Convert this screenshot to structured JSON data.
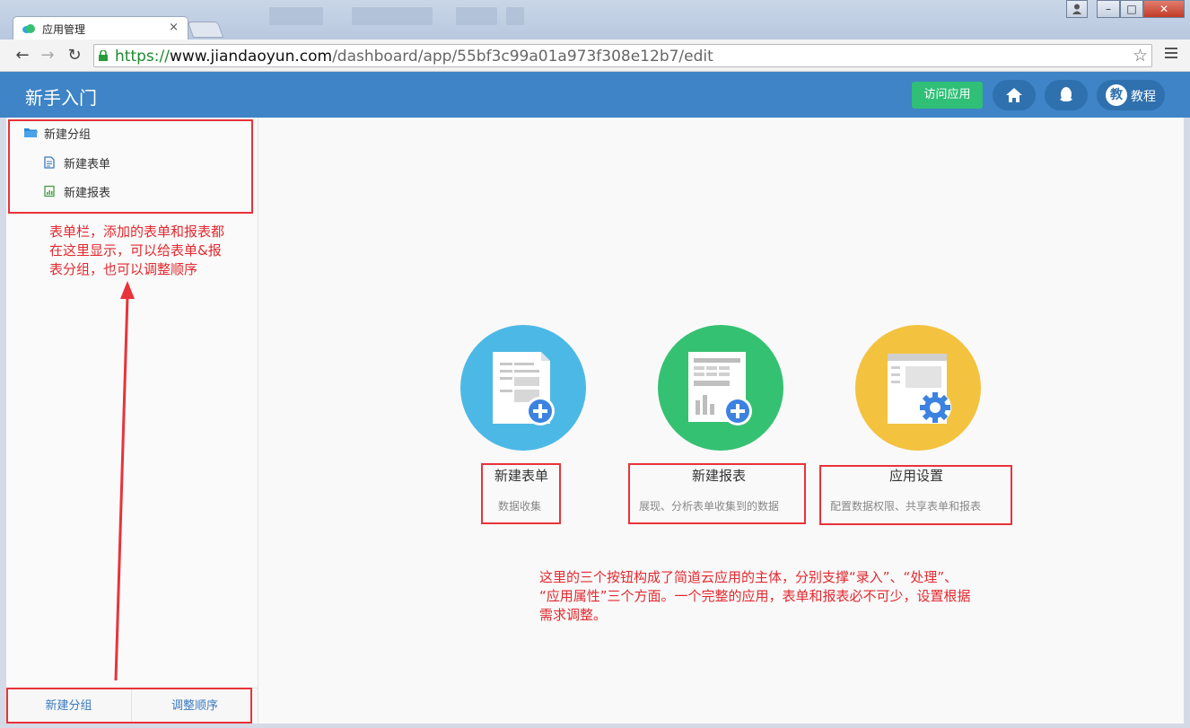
{
  "browser": {
    "tab_title": "应用管理",
    "tab_close": "×",
    "url_scheme": "https://",
    "url_domain": "www.jiandaoyun.com",
    "url_path": "/dashboard/app/55bf3c99a01a973f308e12b7/edit",
    "back": "←",
    "forward": "→",
    "reload": "↻",
    "star": "☆",
    "win_min": "–",
    "win_max": "□",
    "win_close": "✕",
    "win_user": "👤"
  },
  "header": {
    "title": "新手入门",
    "visit_label": "访问应用",
    "tutorial_avatar": "教",
    "tutorial_label": "教程",
    "bg_color": "#3e84c6",
    "visit_color": "#2fbf77"
  },
  "sidebar": {
    "group": {
      "label": "新建分组",
      "icon": "folder-icon"
    },
    "items": [
      {
        "label": "新建表单",
        "icon": "form-icon"
      },
      {
        "label": "新建报表",
        "icon": "report-icon"
      }
    ],
    "footer": {
      "new_group": "新建分组",
      "reorder": "调整顺序"
    }
  },
  "main": {
    "cards": [
      {
        "title": "新建表单",
        "subtitle": "数据收集",
        "color": "#4cb8e6",
        "icon": "form-add-icon"
      },
      {
        "title": "新建报表",
        "subtitle": "展现、分析表单收集到的数据",
        "color": "#35c172",
        "icon": "report-add-icon"
      },
      {
        "title": "应用设置",
        "subtitle": "配置数据权限、共享表单和报表",
        "color": "#f3c23f",
        "icon": "settings-gear-icon"
      }
    ]
  },
  "annotations": {
    "sidebar_note": [
      "表单栏，添加的表单和报表都",
      "在这里显示，可以给表单&报",
      "表分组，也可以调整顺序"
    ],
    "main_note": [
      "这里的三个按钮构成了简道云应用的主体，分别支撑“录入”、“处理”、",
      "“应用属性”三个方面。一个完整的应用，表单和报表必不可少，设置根据",
      "需求调整。"
    ],
    "color": "#e8333a"
  }
}
